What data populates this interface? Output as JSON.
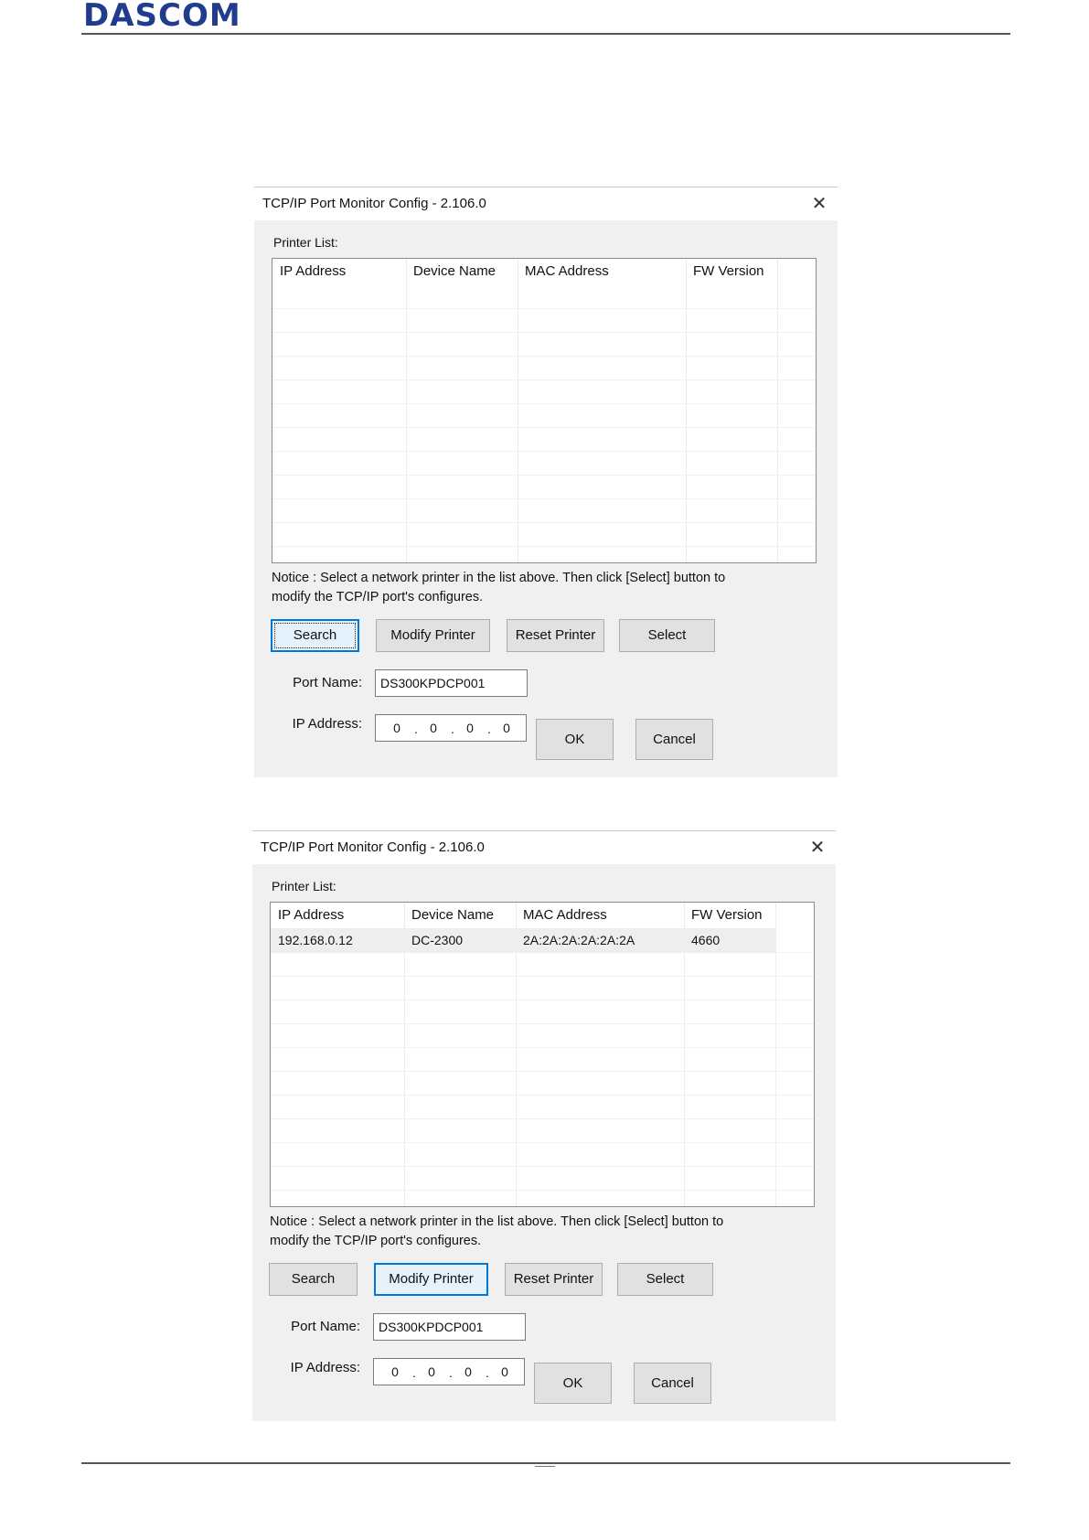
{
  "page": {
    "logo_text": "DASCOM"
  },
  "dialogs": [
    {
      "title": "TCP/IP Port Monitor Config - 2.106.0",
      "printer_list_label": "Printer List:",
      "columns": [
        "IP Address",
        "Device Name",
        "MAC Address",
        "FW Version"
      ],
      "rows": [],
      "notice_line1": "Notice : Select a network printer in the list above. Then click [Select] button to",
      "notice_line2": "modify the TCP/IP port's configures.",
      "buttons": {
        "search": "Search",
        "modify": "Modify Printer",
        "reset": "Reset Printer",
        "select": "Select",
        "ok": "OK",
        "cancel": "Cancel"
      },
      "focused_button": "search",
      "port_name_label": "Port Name:",
      "port_name_value": "DS300KPDCP001",
      "ip_label": "IP Address:",
      "ip_octets": [
        "0",
        "0",
        "0",
        "0"
      ]
    },
    {
      "title": "TCP/IP Port Monitor Config - 2.106.0",
      "printer_list_label": "Printer List:",
      "columns": [
        "IP Address",
        "Device Name",
        "MAC Address",
        "FW Version"
      ],
      "rows": [
        {
          "ip": "192.168.0.12",
          "device": "DC-2300",
          "mac": "2A:2A:2A:2A:2A:2A",
          "fw": "4660"
        }
      ],
      "notice_line1": "Notice : Select a network printer in the list above. Then click [Select] button to",
      "notice_line2": "modify the TCP/IP port's configures.",
      "buttons": {
        "search": "Search",
        "modify": "Modify Printer",
        "reset": "Reset Printer",
        "select": "Select",
        "ok": "OK",
        "cancel": "Cancel"
      },
      "focused_button": "modify",
      "port_name_label": "Port Name:",
      "port_name_value": "DS300KPDCP001",
      "ip_label": "IP Address:",
      "ip_octets": [
        "0",
        "0",
        "0",
        "0"
      ]
    }
  ]
}
